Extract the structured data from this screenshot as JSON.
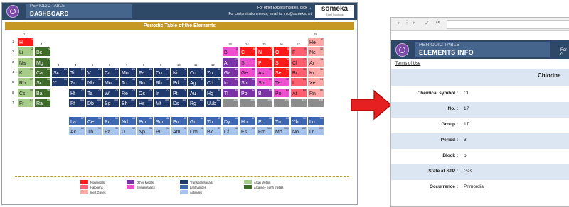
{
  "dashboard": {
    "subtitle": "PERIODIC TABLE",
    "title": "DASHBOARD",
    "info_line1": "For other Excel templates, click →",
    "info_line2": "For customization needs, email to: info@someka.net",
    "brand_name": "someka",
    "brand_tag": "Excel Solutions",
    "logo_icon": "atom-logo-icon",
    "table_title": "Periodic Table of the Elements",
    "groups": [
      "1",
      "2",
      "3",
      "4",
      "5",
      "6",
      "7",
      "8",
      "9",
      "10",
      "11",
      "12",
      "13",
      "14",
      "15",
      "16",
      "17",
      "18"
    ],
    "periods": [
      "1",
      "2",
      "3",
      "4",
      "5",
      "6",
      "7"
    ],
    "elements": [
      {
        "n": "1",
        "s": "H",
        "r": 1,
        "c": 1,
        "cat": "nonmetal"
      },
      {
        "n": "2",
        "s": "He",
        "r": 1,
        "c": 18,
        "cat": "noble"
      },
      {
        "n": "3",
        "s": "Li",
        "r": 2,
        "c": 1,
        "cat": "alkali"
      },
      {
        "n": "4",
        "s": "Be",
        "r": 2,
        "c": 2,
        "cat": "alkaline"
      },
      {
        "n": "5",
        "s": "B",
        "r": 2,
        "c": 13,
        "cat": "semi"
      },
      {
        "n": "6",
        "s": "C",
        "r": 2,
        "c": 14,
        "cat": "nonmetal"
      },
      {
        "n": "7",
        "s": "N",
        "r": 2,
        "c": 15,
        "cat": "nonmetal"
      },
      {
        "n": "8",
        "s": "O",
        "r": 2,
        "c": 16,
        "cat": "nonmetal"
      },
      {
        "n": "9",
        "s": "F",
        "r": 2,
        "c": 17,
        "cat": "halogen"
      },
      {
        "n": "10",
        "s": "Ne",
        "r": 2,
        "c": 18,
        "cat": "noble"
      },
      {
        "n": "11",
        "s": "Na",
        "r": 3,
        "c": 1,
        "cat": "alkali"
      },
      {
        "n": "12",
        "s": "Mg",
        "r": 3,
        "c": 2,
        "cat": "alkaline"
      },
      {
        "n": "13",
        "s": "Al",
        "r": 3,
        "c": 13,
        "cat": "other"
      },
      {
        "n": "14",
        "s": "Si",
        "r": 3,
        "c": 14,
        "cat": "semi"
      },
      {
        "n": "15",
        "s": "P",
        "r": 3,
        "c": 15,
        "cat": "nonmetal"
      },
      {
        "n": "16",
        "s": "S",
        "r": 3,
        "c": 16,
        "cat": "nonmetal"
      },
      {
        "n": "17",
        "s": "Cl",
        "r": 3,
        "c": 17,
        "cat": "halogen"
      },
      {
        "n": "18",
        "s": "Ar",
        "r": 3,
        "c": 18,
        "cat": "noble"
      },
      {
        "n": "19",
        "s": "K",
        "r": 4,
        "c": 1,
        "cat": "alkali"
      },
      {
        "n": "20",
        "s": "Ca",
        "r": 4,
        "c": 2,
        "cat": "alkaline"
      },
      {
        "n": "21",
        "s": "Sc",
        "r": 4,
        "c": 3,
        "cat": "transition"
      },
      {
        "n": "22",
        "s": "Ti",
        "r": 4,
        "c": 4,
        "cat": "transition"
      },
      {
        "n": "23",
        "s": "V",
        "r": 4,
        "c": 5,
        "cat": "transition"
      },
      {
        "n": "24",
        "s": "Cr",
        "r": 4,
        "c": 6,
        "cat": "transition"
      },
      {
        "n": "25",
        "s": "Mn",
        "r": 4,
        "c": 7,
        "cat": "transition"
      },
      {
        "n": "26",
        "s": "Fe",
        "r": 4,
        "c": 8,
        "cat": "transition"
      },
      {
        "n": "27",
        "s": "Co",
        "r": 4,
        "c": 9,
        "cat": "transition"
      },
      {
        "n": "28",
        "s": "Ni",
        "r": 4,
        "c": 10,
        "cat": "transition"
      },
      {
        "n": "29",
        "s": "Cu",
        "r": 4,
        "c": 11,
        "cat": "transition"
      },
      {
        "n": "30",
        "s": "Zn",
        "r": 4,
        "c": 12,
        "cat": "transition"
      },
      {
        "n": "31",
        "s": "Ga",
        "r": 4,
        "c": 13,
        "cat": "other"
      },
      {
        "n": "32",
        "s": "Ge",
        "r": 4,
        "c": 14,
        "cat": "semi"
      },
      {
        "n": "33",
        "s": "As",
        "r": 4,
        "c": 15,
        "cat": "semi"
      },
      {
        "n": "34",
        "s": "Se",
        "r": 4,
        "c": 16,
        "cat": "nonmetal"
      },
      {
        "n": "35",
        "s": "Br",
        "r": 4,
        "c": 17,
        "cat": "halogen"
      },
      {
        "n": "36",
        "s": "Kr",
        "r": 4,
        "c": 18,
        "cat": "noble"
      },
      {
        "n": "37",
        "s": "Rb",
        "r": 5,
        "c": 1,
        "cat": "alkali"
      },
      {
        "n": "38",
        "s": "Sr",
        "r": 5,
        "c": 2,
        "cat": "alkaline"
      },
      {
        "n": "39",
        "s": "Y",
        "r": 5,
        "c": 3,
        "cat": "transition"
      },
      {
        "n": "40",
        "s": "Zr",
        "r": 5,
        "c": 4,
        "cat": "transition"
      },
      {
        "n": "41",
        "s": "Nb",
        "r": 5,
        "c": 5,
        "cat": "transition"
      },
      {
        "n": "42",
        "s": "Mo",
        "r": 5,
        "c": 6,
        "cat": "transition"
      },
      {
        "n": "43",
        "s": "Tc",
        "r": 5,
        "c": 7,
        "cat": "transition"
      },
      {
        "n": "44",
        "s": "Ru",
        "r": 5,
        "c": 8,
        "cat": "transition"
      },
      {
        "n": "45",
        "s": "Rh",
        "r": 5,
        "c": 9,
        "cat": "transition"
      },
      {
        "n": "46",
        "s": "Pd",
        "r": 5,
        "c": 10,
        "cat": "transition"
      },
      {
        "n": "47",
        "s": "Ag",
        "r": 5,
        "c": 11,
        "cat": "transition"
      },
      {
        "n": "48",
        "s": "Cd",
        "r": 5,
        "c": 12,
        "cat": "transition"
      },
      {
        "n": "49",
        "s": "In",
        "r": 5,
        "c": 13,
        "cat": "other"
      },
      {
        "n": "50",
        "s": "Sn",
        "r": 5,
        "c": 14,
        "cat": "other"
      },
      {
        "n": "51",
        "s": "Sb",
        "r": 5,
        "c": 15,
        "cat": "semi"
      },
      {
        "n": "52",
        "s": "Te",
        "r": 5,
        "c": 16,
        "cat": "semi"
      },
      {
        "n": "53",
        "s": "I",
        "r": 5,
        "c": 17,
        "cat": "halogen"
      },
      {
        "n": "54",
        "s": "Xe",
        "r": 5,
        "c": 18,
        "cat": "noble"
      },
      {
        "n": "55",
        "s": "Cs",
        "r": 6,
        "c": 1,
        "cat": "alkali"
      },
      {
        "n": "56",
        "s": "Ba",
        "r": 6,
        "c": 2,
        "cat": "alkaline"
      },
      {
        "n": "72",
        "s": "Hf",
        "r": 6,
        "c": 4,
        "cat": "transition"
      },
      {
        "n": "73",
        "s": "Ta",
        "r": 6,
        "c": 5,
        "cat": "transition"
      },
      {
        "n": "74",
        "s": "W",
        "r": 6,
        "c": 6,
        "cat": "transition"
      },
      {
        "n": "75",
        "s": "Re",
        "r": 6,
        "c": 7,
        "cat": "transition"
      },
      {
        "n": "76",
        "s": "Os",
        "r": 6,
        "c": 8,
        "cat": "transition"
      },
      {
        "n": "77",
        "s": "Ir",
        "r": 6,
        "c": 9,
        "cat": "transition"
      },
      {
        "n": "78",
        "s": "Pt",
        "r": 6,
        "c": 10,
        "cat": "transition"
      },
      {
        "n": "79",
        "s": "Au",
        "r": 6,
        "c": 11,
        "cat": "transition"
      },
      {
        "n": "80",
        "s": "Hg",
        "r": 6,
        "c": 12,
        "cat": "transition"
      },
      {
        "n": "81",
        "s": "Tl",
        "r": 6,
        "c": 13,
        "cat": "other"
      },
      {
        "n": "82",
        "s": "Pb",
        "r": 6,
        "c": 14,
        "cat": "other"
      },
      {
        "n": "83",
        "s": "Bi",
        "r": 6,
        "c": 15,
        "cat": "other"
      },
      {
        "n": "84",
        "s": "Po",
        "r": 6,
        "c": 16,
        "cat": "semi"
      },
      {
        "n": "85",
        "s": "At",
        "r": 6,
        "c": 17,
        "cat": "halogen"
      },
      {
        "n": "86",
        "s": "Rn",
        "r": 6,
        "c": 18,
        "cat": "noble"
      },
      {
        "n": "87",
        "s": "Fr",
        "r": 7,
        "c": 1,
        "cat": "alkali"
      },
      {
        "n": "88",
        "s": "Ra",
        "r": 7,
        "c": 2,
        "cat": "alkaline"
      },
      {
        "n": "104",
        "s": "Rf",
        "r": 7,
        "c": 4,
        "cat": "transition"
      },
      {
        "n": "105",
        "s": "Db",
        "r": 7,
        "c": 5,
        "cat": "transition"
      },
      {
        "n": "106",
        "s": "Sg",
        "r": 7,
        "c": 6,
        "cat": "transition"
      },
      {
        "n": "107",
        "s": "Bh",
        "r": 7,
        "c": 7,
        "cat": "transition"
      },
      {
        "n": "108",
        "s": "Hs",
        "r": 7,
        "c": 8,
        "cat": "transition"
      },
      {
        "n": "109",
        "s": "Mt",
        "r": 7,
        "c": 9,
        "cat": "transition"
      },
      {
        "n": "110",
        "s": "Ds",
        "r": 7,
        "c": 10,
        "cat": "transition"
      },
      {
        "n": "111",
        "s": "Rg",
        "r": 7,
        "c": 11,
        "cat": "transition"
      },
      {
        "n": "112",
        "s": "Uub",
        "r": 7,
        "c": 12,
        "cat": "transition"
      },
      {
        "n": "113",
        "s": "",
        "r": 7,
        "c": 13,
        "cat": "unknown"
      },
      {
        "n": "114",
        "s": "",
        "r": 7,
        "c": 14,
        "cat": "unknown"
      },
      {
        "n": "115",
        "s": "",
        "r": 7,
        "c": 15,
        "cat": "unknown"
      },
      {
        "n": "116",
        "s": "",
        "r": 7,
        "c": 16,
        "cat": "unknown"
      },
      {
        "n": "117",
        "s": "",
        "r": 7,
        "c": 17,
        "cat": "unknown"
      },
      {
        "n": "118",
        "s": "",
        "r": 7,
        "c": 18,
        "cat": "unknown"
      },
      {
        "n": "57",
        "s": "La",
        "r": 9,
        "c": 4,
        "cat": "lanthanide"
      },
      {
        "n": "58",
        "s": "Ce",
        "r": 9,
        "c": 5,
        "cat": "lanthanide"
      },
      {
        "n": "59",
        "s": "Pr",
        "r": 9,
        "c": 6,
        "cat": "lanthanide"
      },
      {
        "n": "60",
        "s": "Nd",
        "r": 9,
        "c": 7,
        "cat": "lanthanide"
      },
      {
        "n": "61",
        "s": "Pm",
        "r": 9,
        "c": 8,
        "cat": "lanthanide"
      },
      {
        "n": "62",
        "s": "Sm",
        "r": 9,
        "c": 9,
        "cat": "lanthanide"
      },
      {
        "n": "63",
        "s": "Eu",
        "r": 9,
        "c": 10,
        "cat": "lanthanide"
      },
      {
        "n": "64",
        "s": "Gd",
        "r": 9,
        "c": 11,
        "cat": "lanthanide"
      },
      {
        "n": "65",
        "s": "Tb",
        "r": 9,
        "c": 12,
        "cat": "lanthanide"
      },
      {
        "n": "66",
        "s": "Dy",
        "r": 9,
        "c": 13,
        "cat": "lanthanide"
      },
      {
        "n": "67",
        "s": "Ho",
        "r": 9,
        "c": 14,
        "cat": "lanthanide"
      },
      {
        "n": "68",
        "s": "Er",
        "r": 9,
        "c": 15,
        "cat": "lanthanide"
      },
      {
        "n": "69",
        "s": "Tm",
        "r": 9,
        "c": 16,
        "cat": "lanthanide"
      },
      {
        "n": "70",
        "s": "Yb",
        "r": 9,
        "c": 17,
        "cat": "lanthanide"
      },
      {
        "n": "71",
        "s": "Lu",
        "r": 9,
        "c": 18,
        "cat": "lanthanide"
      },
      {
        "n": "89",
        "s": "Ac",
        "r": 10,
        "c": 4,
        "cat": "actinide"
      },
      {
        "n": "90",
        "s": "Th",
        "r": 10,
        "c": 5,
        "cat": "actinide"
      },
      {
        "n": "91",
        "s": "Pa",
        "r": 10,
        "c": 6,
        "cat": "actinide"
      },
      {
        "n": "92",
        "s": "U",
        "r": 10,
        "c": 7,
        "cat": "actinide"
      },
      {
        "n": "93",
        "s": "Np",
        "r": 10,
        "c": 8,
        "cat": "actinide"
      },
      {
        "n": "94",
        "s": "Pu",
        "r": 10,
        "c": 9,
        "cat": "actinide"
      },
      {
        "n": "95",
        "s": "Am",
        "r": 10,
        "c": 10,
        "cat": "actinide"
      },
      {
        "n": "96",
        "s": "Cm",
        "r": 10,
        "c": 11,
        "cat": "actinide"
      },
      {
        "n": "97",
        "s": "Bk",
        "r": 10,
        "c": 12,
        "cat": "actinide"
      },
      {
        "n": "98",
        "s": "Cf",
        "r": 10,
        "c": 13,
        "cat": "actinide"
      },
      {
        "n": "99",
        "s": "Es",
        "r": 10,
        "c": 14,
        "cat": "actinide"
      },
      {
        "n": "100",
        "s": "Fm",
        "r": 10,
        "c": 15,
        "cat": "actinide"
      },
      {
        "n": "101",
        "s": "Md",
        "r": 10,
        "c": 16,
        "cat": "actinide"
      },
      {
        "n": "102",
        "s": "No",
        "r": 10,
        "c": 17,
        "cat": "actinide"
      },
      {
        "n": "103",
        "s": "Lr",
        "r": 10,
        "c": 18,
        "cat": "actinide"
      }
    ],
    "colors": {
      "nonmetal": "#ff1a1a",
      "halogen": "#ff5f6e",
      "noble": "#ffa8a8",
      "other": "#7a32a6",
      "semi": "#ee4fcf",
      "transition": "#203a6e",
      "lanthanide": "#3d67b0",
      "actinide": "#a9c4ec",
      "alkali": "#a6cc88",
      "alkaline": "#3e6a2a",
      "unknown": "#8c8c8c"
    },
    "legend": [
      {
        "label": "Nonmetals",
        "cat": "nonmetal"
      },
      {
        "label": "Halogens",
        "cat": "halogen"
      },
      {
        "label": "Inert Gases",
        "cat": "noble"
      },
      {
        "label": "Other Metals",
        "cat": "other"
      },
      {
        "label": "Semimetallics",
        "cat": "semi"
      },
      {
        "label": "Transition Metals",
        "cat": "transition"
      },
      {
        "label": "Lanthanides",
        "cat": "lanthanide"
      },
      {
        "label": "Actinides",
        "cat": "actinide"
      },
      {
        "label": "Alkali Metals",
        "cat": "alkali"
      },
      {
        "label": "Alkaline - earth metals",
        "cat": "alkaline"
      }
    ]
  },
  "arrow_icon": "right-arrow-icon",
  "formula_bar": {
    "close_icon": "×",
    "check_icon": "✓",
    "fx_label": "fx"
  },
  "elements_info": {
    "subtitle": "PERIODIC TABLE",
    "title": "ELEMENTS INFO",
    "header_fragment": "For c",
    "terms_link": "Terms of Use",
    "element_name": "Chlorine",
    "rows": [
      {
        "label": "Chemical symbol :",
        "value": "Cl"
      },
      {
        "label": "No. :",
        "value": "17"
      },
      {
        "label": "Group :",
        "value": "17"
      },
      {
        "label": "Period :",
        "value": "3"
      },
      {
        "label": "Block :",
        "value": "p"
      },
      {
        "label": "State at STP :",
        "value": "Gas"
      },
      {
        "label": "Occurrence :",
        "value": "Primordial"
      }
    ]
  }
}
